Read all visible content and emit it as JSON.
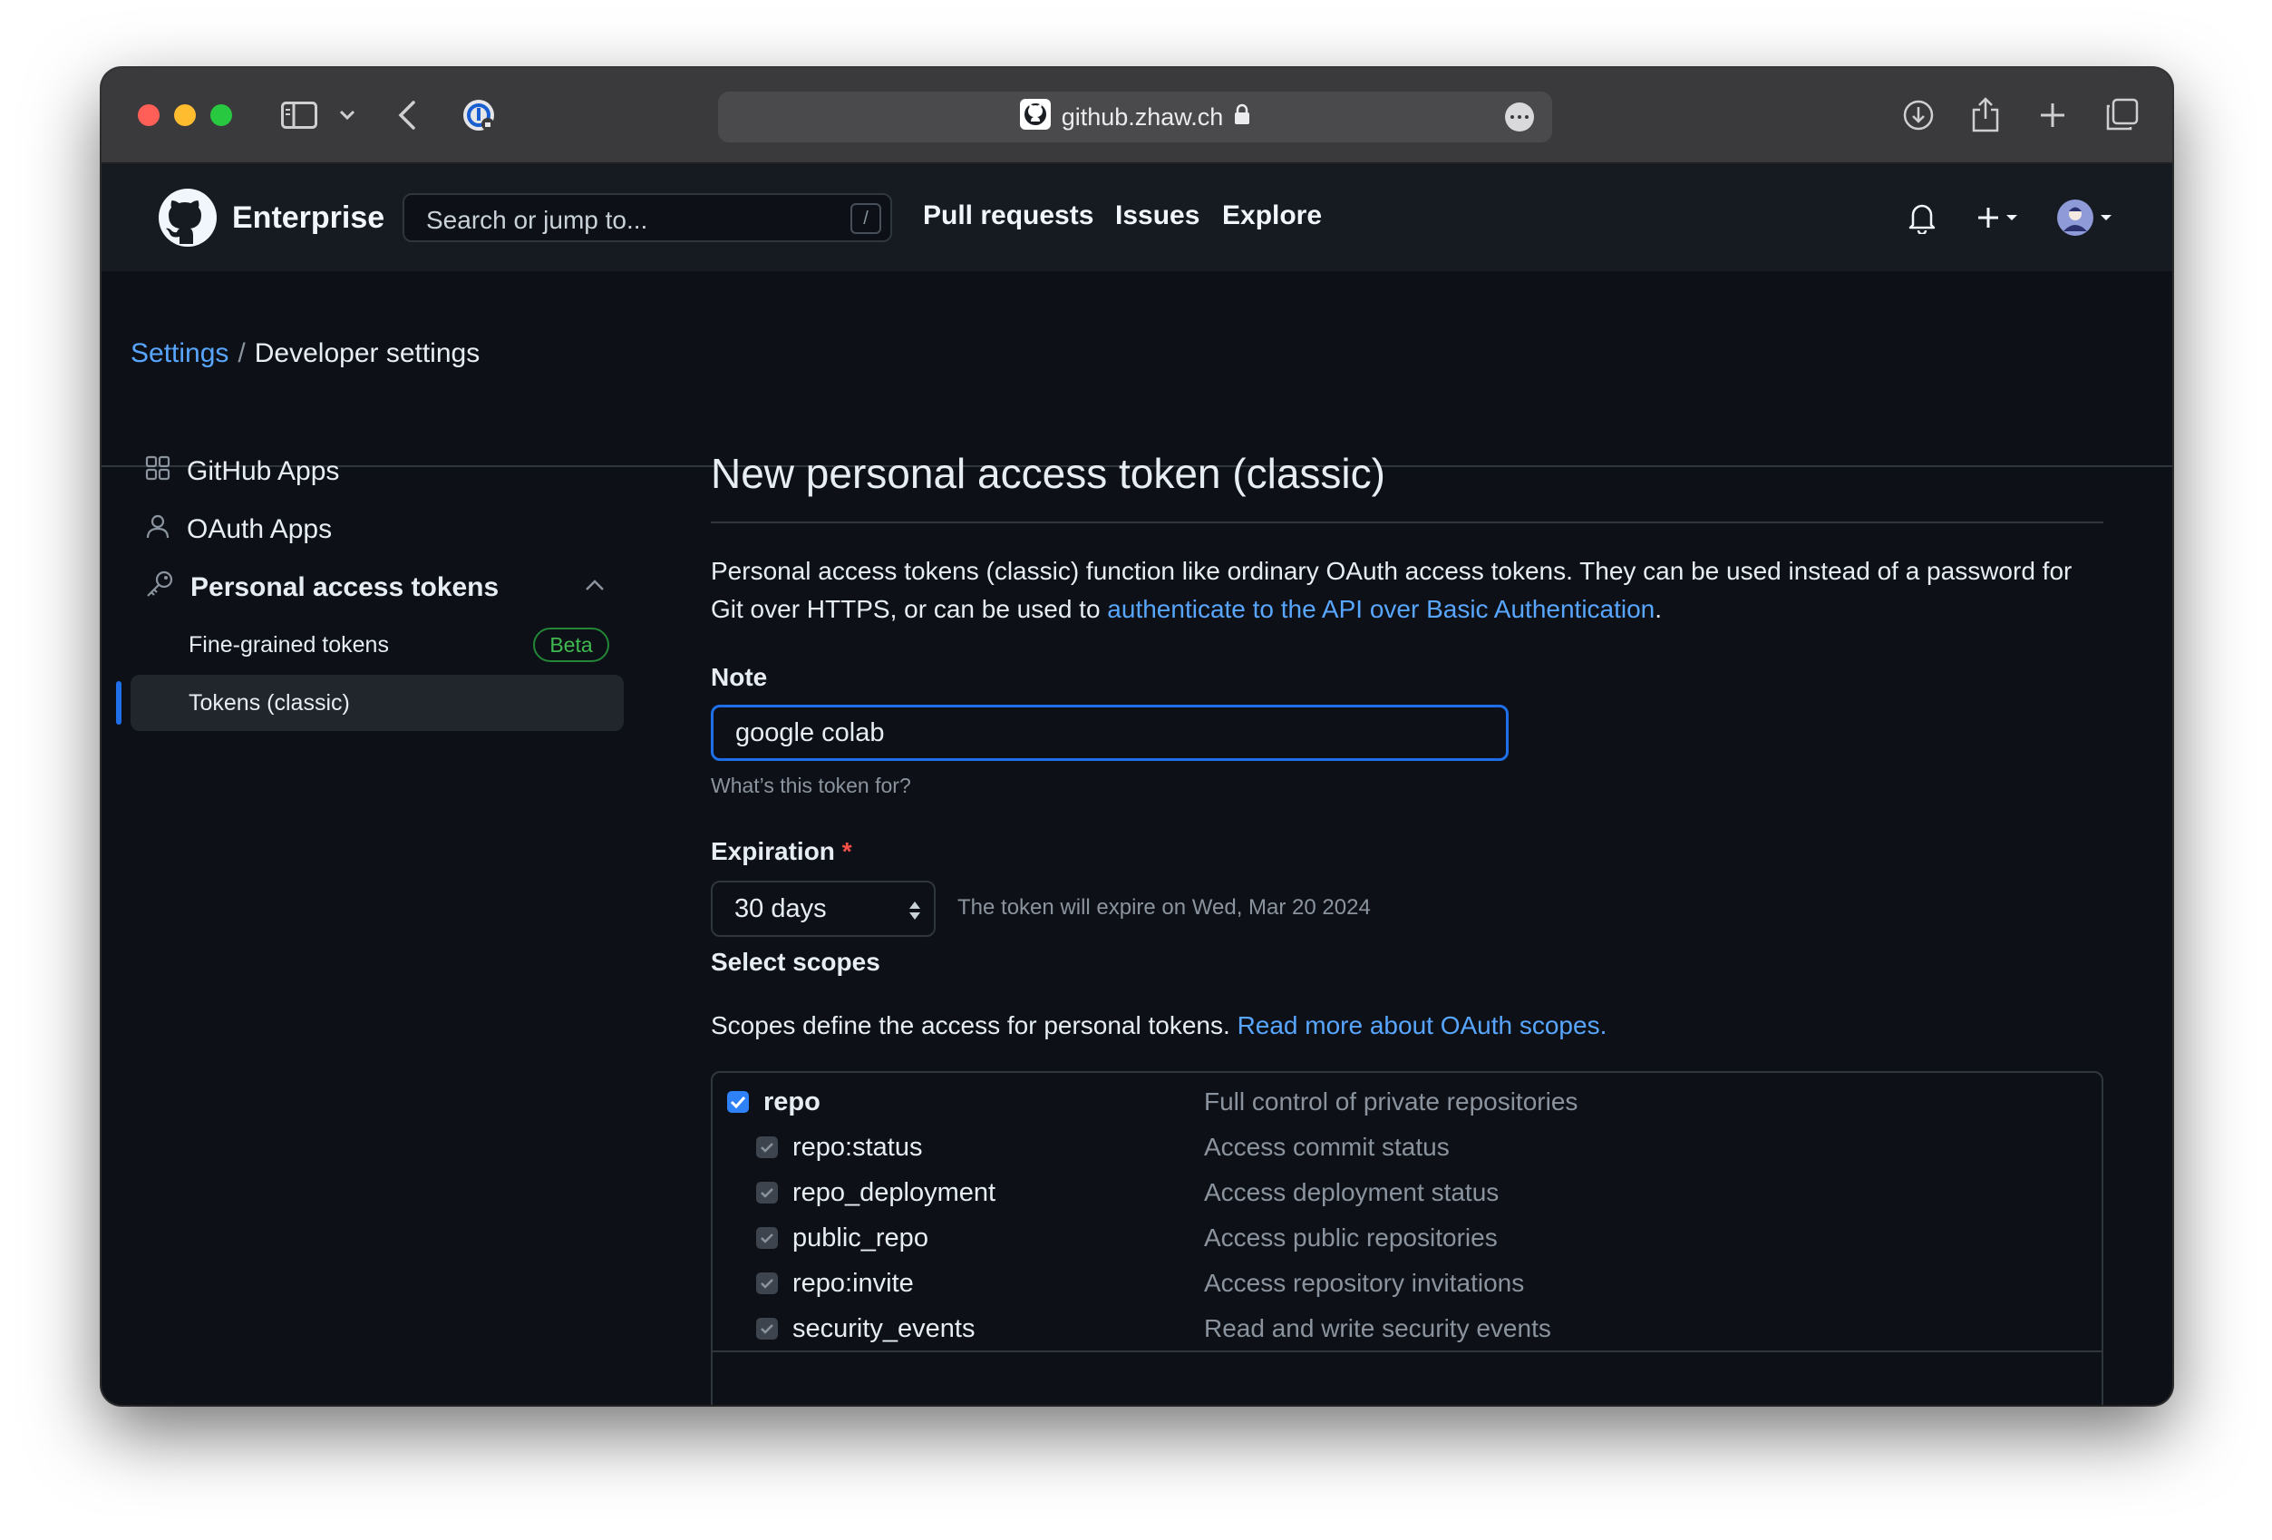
{
  "browser": {
    "url": "github.zhaw.ch"
  },
  "header": {
    "brand": "Enterprise",
    "search_placeholder": "Search or jump to...",
    "search_shortcut": "/",
    "nav": [
      "Pull requests",
      "Issues",
      "Explore"
    ]
  },
  "breadcrumb": {
    "settings": "Settings",
    "separator": "/",
    "current": "Developer settings"
  },
  "sidebar": {
    "items": [
      {
        "label": "GitHub Apps",
        "icon": "apps-icon"
      },
      {
        "label": "OAuth Apps",
        "icon": "person-icon"
      },
      {
        "label": "Personal access tokens",
        "icon": "key-icon"
      }
    ],
    "sub_items": [
      {
        "label": "Fine-grained tokens",
        "badge": "Beta"
      },
      {
        "label": "Tokens (classic)"
      }
    ]
  },
  "main": {
    "title": "New personal access token (classic)",
    "description_text": "Personal access tokens (classic) function like ordinary OAuth access tokens. They can be used instead of a password for Git over HTTPS, or can be used to ",
    "description_link": "authenticate to the API over Basic Authentication",
    "description_end": ".",
    "note_label": "Note",
    "note_value": "google colab",
    "note_hint": "What’s this token for?",
    "expiration_label": "Expiration",
    "expiration_required": "*",
    "expiration_value": "30 days",
    "expiration_note": "The token will expire on Wed, Mar 20 2024",
    "scopes_label": "Select scopes",
    "scopes_desc": "Scopes define the access for personal tokens. ",
    "scopes_link": "Read more about OAuth scopes.",
    "scopes": [
      {
        "name": "repo",
        "desc": "Full control of private repositories",
        "checked": true,
        "sub": false
      },
      {
        "name": "repo:status",
        "desc": "Access commit status",
        "checked": true,
        "sub": true
      },
      {
        "name": "repo_deployment",
        "desc": "Access deployment status",
        "checked": true,
        "sub": true
      },
      {
        "name": "public_repo",
        "desc": "Access public repositories",
        "checked": true,
        "sub": true
      },
      {
        "name": "repo:invite",
        "desc": "Access repository invitations",
        "checked": true,
        "sub": true
      },
      {
        "name": "security_events",
        "desc": "Read and write security events",
        "checked": true,
        "sub": true
      }
    ]
  },
  "colors": {
    "accent": "#58a6ff",
    "focus": "#1f6feb",
    "bg": "#0d1117",
    "header_bg": "#161b22",
    "beta": "#3fb950"
  }
}
